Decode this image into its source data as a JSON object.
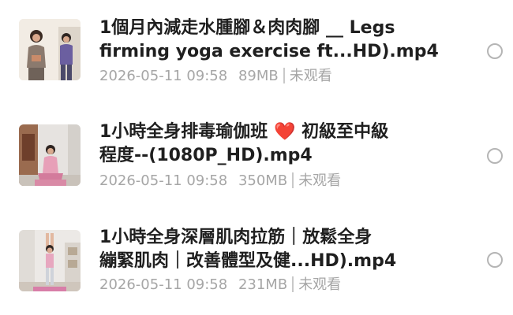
{
  "files": [
    {
      "title_line1": "1個月內減走水腫腳＆肉肉腳 __ Legs",
      "title_line2": "firming yoga exercise ft...HD).mp4",
      "date": "2026-05-11 09:58",
      "size": "89MB",
      "status": "未观看",
      "thumbnail_icon": "video-thumbnail-two-women-standing"
    },
    {
      "title_line1_a": "1小時全身排毒瑜伽班",
      "title_line1_heart": "❤️",
      "title_line1_b": "初級至中級",
      "title_line2": "程度--(1080P_HD).mp4",
      "date": "2026-05-11 09:58",
      "size": "350MB",
      "status": "未观看",
      "thumbnail_icon": "video-thumbnail-woman-sitting-yoga"
    },
    {
      "title_line1": "1小時全身深層肌肉拉筋｜放鬆全身",
      "title_line2": "繃緊肌肉｜改善體型及健...HD).mp4",
      "date": "2026-05-11 09:58",
      "size": "231MB",
      "status": "未观看",
      "thumbnail_icon": "video-thumbnail-woman-stretching"
    }
  ],
  "colors": {
    "title": "#1f1f1f",
    "meta": "#a6a6a6",
    "radio_border": "#b5b5b5",
    "heart": "#e02b2b"
  }
}
